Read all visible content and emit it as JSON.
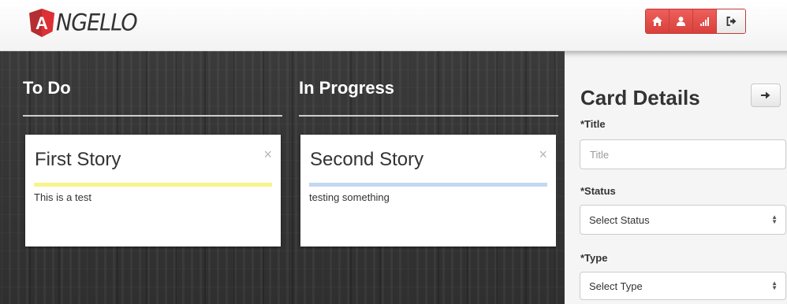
{
  "app": {
    "logo_letter": "A",
    "logo_text": "NGELLO"
  },
  "nav": {
    "items": [
      {
        "icon": "home-icon"
      },
      {
        "icon": "user-icon"
      },
      {
        "icon": "stats-icon"
      },
      {
        "icon": "logout-icon"
      }
    ]
  },
  "columns": [
    {
      "title": "To Do",
      "cards": [
        {
          "title": "First Story",
          "description": "This is a test",
          "close": "×",
          "color": "#f7f48b"
        }
      ]
    },
    {
      "title": "In Progress",
      "cards": [
        {
          "title": "Second Story",
          "description": "testing something",
          "close": "×",
          "color": "#c4d8f2"
        }
      ]
    }
  ],
  "details": {
    "title": "Card Details",
    "collapse_icon": "arrow-right-icon",
    "fields": {
      "title_label": "*Title",
      "title_placeholder": "Title",
      "status_label": "*Status",
      "status_value": "Select Status",
      "type_label": "*Type",
      "type_value": "Select Type"
    }
  },
  "colors": {
    "nav_red": "#dc4642",
    "board_dark": "#353535",
    "todo_bar": "#f7f48b",
    "progress_bar": "#c4d8f2"
  }
}
